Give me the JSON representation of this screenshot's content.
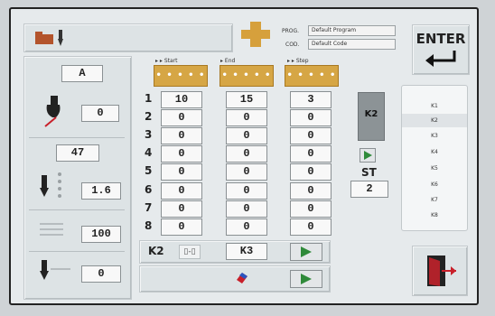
{
  "header": {
    "prog_label": "PROG.",
    "prog_value": "Default Program",
    "cod_label": "COD.",
    "cod_value": "Default Code",
    "enter_label": "ENTER"
  },
  "left": {
    "mode": "A",
    "tool_value": "0",
    "value_47": "47",
    "step_value": "1.6",
    "speed_value": "100",
    "bottom_value": "0"
  },
  "table": {
    "headers": {
      "start": "Start",
      "end": "End",
      "step": "Step"
    },
    "dots": "• • • • •",
    "rows": [
      {
        "n": "1",
        "start": "10",
        "end": "15",
        "step": "3"
      },
      {
        "n": "2",
        "start": "0",
        "end": "0",
        "step": "0"
      },
      {
        "n": "3",
        "start": "0",
        "end": "0",
        "step": "0"
      },
      {
        "n": "4",
        "start": "0",
        "end": "0",
        "step": "0"
      },
      {
        "n": "5",
        "start": "0",
        "end": "0",
        "step": "0"
      },
      {
        "n": "6",
        "start": "0",
        "end": "0",
        "step": "0"
      },
      {
        "n": "7",
        "start": "0",
        "end": "0",
        "step": "0"
      },
      {
        "n": "8",
        "start": "0",
        "end": "0",
        "step": "0"
      }
    ]
  },
  "right": {
    "k_selected_label": "K2",
    "st_label": "ST",
    "st_value": "2",
    "k_list": [
      "K1",
      "K2",
      "K3",
      "K4",
      "K5",
      "K6",
      "K7",
      "K8"
    ],
    "k_selected_index": 1
  },
  "bottom": {
    "from_label": "K2",
    "to_label": "K3"
  },
  "colors": {
    "accent_orange": "#d6a645",
    "play_green": "#2f8a3a",
    "exit_red": "#c8202a"
  }
}
